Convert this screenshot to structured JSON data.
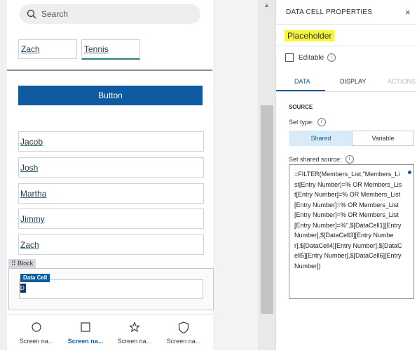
{
  "search": {
    "placeholder": "Search"
  },
  "row_fields": {
    "first": "Zach",
    "second": "Tennis"
  },
  "button": {
    "label": "Button"
  },
  "list": {
    "items": [
      "Jacob",
      "Josh",
      "Martha",
      "Jimmy",
      "Zach"
    ]
  },
  "block": {
    "tag": "Block",
    "data_cell_tag": "Data Cell",
    "cursor_glyph": "D"
  },
  "nav": {
    "items": [
      {
        "label": "Screen na...",
        "icon": "circle-icon",
        "active": false
      },
      {
        "label": "Screen na...",
        "icon": "square-icon",
        "active": true
      },
      {
        "label": "Screen na...",
        "icon": "star-icon",
        "active": false
      },
      {
        "label": "Screen na...",
        "icon": "shield-icon",
        "active": false
      }
    ]
  },
  "panel": {
    "title": "DATA CELL PROPERTIES",
    "close": "×",
    "name": "Placeholder",
    "editable_label": "Editable",
    "tabs": [
      "DATA",
      "DISPLAY",
      "ACTIONS"
    ],
    "section": "SOURCE",
    "set_type_label": "Set type:",
    "segment_shared": "Shared",
    "segment_variable": "Variable",
    "set_source_label": "Set shared source:",
    "formula": "=FILTER(Members_List,\"Members_List[Entry Number]=% OR Members_List[Entry Number]=% OR Members_List[Entry Number]=% OR Members_List[Entry Number]=% OR Members_List[Entry Number]=%\",$[DataCell1][Entry Number],$[DataCell3][Entry Number],$[DataCell4][Entry Number],$[DataCell5][Entry Number],$[DataCell6][Entry Number])"
  },
  "colors": {
    "accent": "#0f5ba1",
    "highlight": "#f8f53d"
  }
}
